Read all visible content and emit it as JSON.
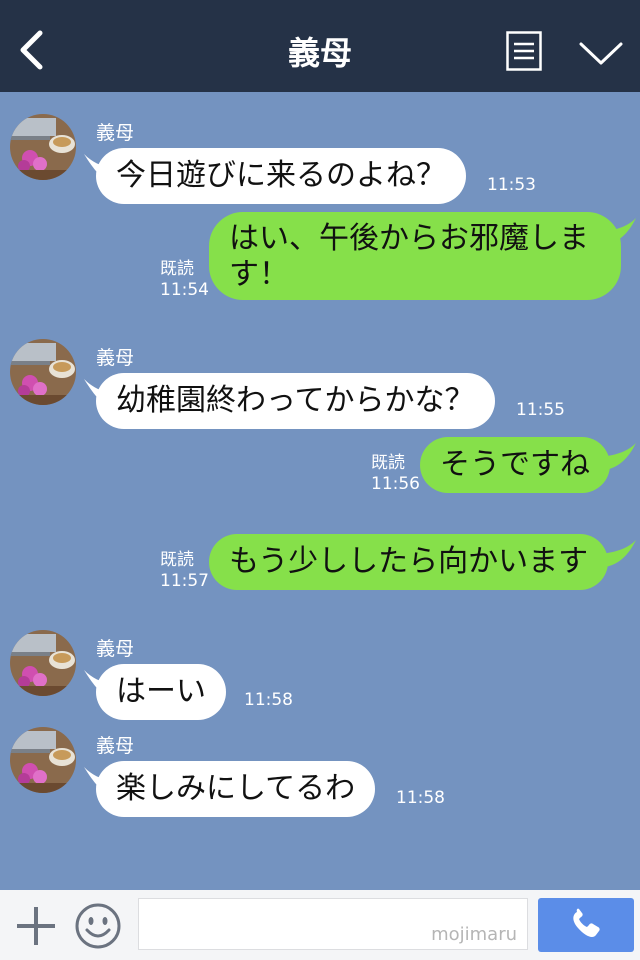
{
  "header": {
    "title": "義母"
  },
  "messages": [
    {
      "sender": "義母",
      "text": "今日遊びに来るのよね？",
      "time": "11:53"
    },
    {
      "line1": "はい、午後からお邪魔しま",
      "line2": "す！",
      "read": "既読",
      "time": "11:54"
    },
    {
      "sender": "義母",
      "text": "幼稚園終わってからかな？",
      "time": "11:55"
    },
    {
      "text": "そうですね",
      "read": "既読",
      "time": "11:56"
    },
    {
      "text": "もう少ししたら向かいます",
      "read": "既読",
      "time": "11:57"
    },
    {
      "sender": "義母",
      "text": "はーい",
      "time": "11:58"
    },
    {
      "sender": "義母",
      "text": "楽しみにしてるわ",
      "time": "11:58"
    }
  ],
  "footer": {
    "watermark": "mojimaru"
  },
  "colors": {
    "background": "#7493c0",
    "header": "#253247",
    "outgoing": "#86e04a",
    "incoming": "#ffffff",
    "send": "#5b8de8"
  }
}
